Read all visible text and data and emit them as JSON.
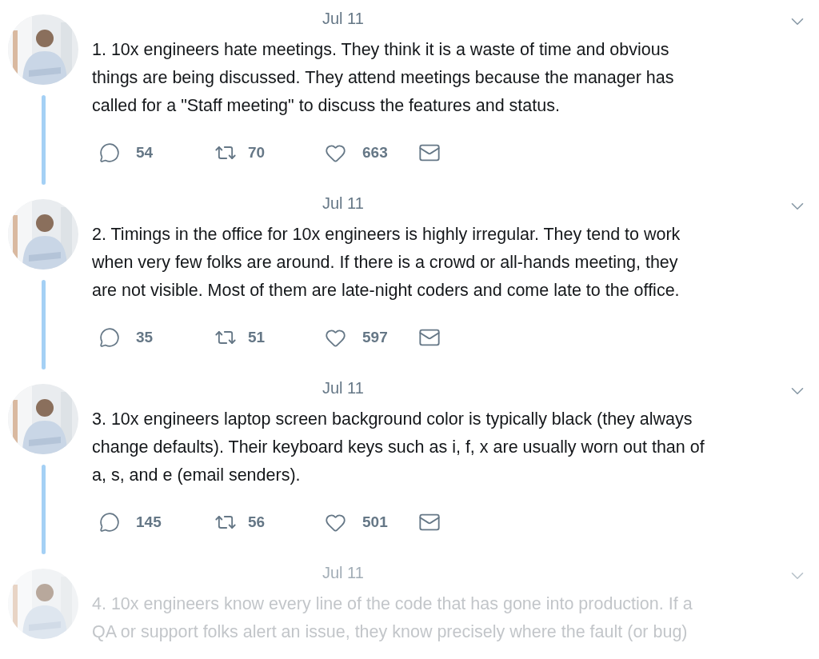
{
  "tweets": [
    {
      "date": "Jul 11",
      "faded": false,
      "lines": [
        "1. 10x engineers hate meetings. They think it is a waste of time and obvious",
        "things are being discussed. They attend meetings because the manager has",
        "called for a \"Staff meeting\" to discuss the features and status."
      ],
      "replies": "54",
      "retweets": "70",
      "likes": "663"
    },
    {
      "date": "Jul 11",
      "faded": false,
      "lines": [
        "2. Timings in the office for 10x engineers is highly irregular. They tend to work",
        "when very few folks are around. If there is a crowd or all-hands meeting, they",
        "are not visible. Most of them are late-night coders and come late to the office."
      ],
      "replies": "35",
      "retweets": "51",
      "likes": "597"
    },
    {
      "date": "Jul 11",
      "faded": false,
      "lines": [
        "3. 10x engineers laptop screen background color is typically black (they always",
        "change defaults). Their keyboard keys such as i, f, x are usually worn out than of",
        "a, s, and e (email senders)."
      ],
      "replies": "145",
      "retweets": "56",
      "likes": "501"
    },
    {
      "date": "Jul 11",
      "faded": true,
      "lines": [
        "4. 10x engineers know every line of the code that has gone into production. If a",
        "QA or support folks alert an issue, they know precisely where the fault (or bug)"
      ]
    }
  ]
}
